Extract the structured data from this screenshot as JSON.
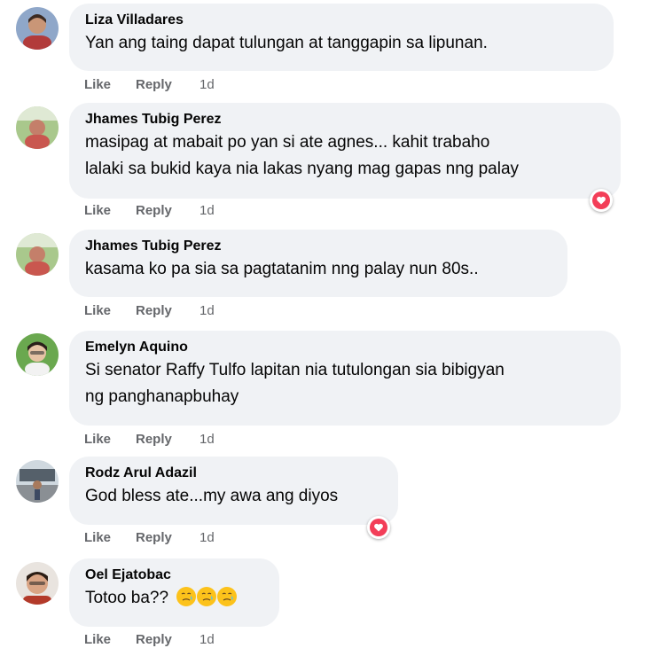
{
  "actions": {
    "like": "Like",
    "reply": "Reply"
  },
  "comments": [
    {
      "author": "Liza Villadares",
      "lines": [
        "Yan ang taing dapat tulungan at tanggapin sa lipunan."
      ],
      "time": "1d",
      "reaction": null
    },
    {
      "author": "Jhames Tubig Perez",
      "lines": [
        "masipag at mabait po yan si ate agnes... kahit trabaho",
        "lalaki sa bukid kaya nia lakas nyang mag gapas nng palay"
      ],
      "time": "1d",
      "reaction": "heart"
    },
    {
      "author": "Jhames Tubig Perez",
      "lines": [
        "kasama ko pa sia sa pagtatanim nng palay nun 80s.."
      ],
      "time": "1d",
      "reaction": null
    },
    {
      "author": "Emelyn Aquino",
      "lines": [
        "Si senator Raffy Tulfo lapitan nia tutulongan sia bibigyan",
        "ng panghanapbuhay"
      ],
      "time": "1d",
      "reaction": null
    },
    {
      "author": "Rodz Arul Adazil",
      "lines": [
        "God bless ate...my awa ang diyos"
      ],
      "time": "1d",
      "reaction": "heart"
    },
    {
      "author": "Oel Ejatobac",
      "lines": [
        "Totoo ba??"
      ],
      "emojis": [
        "crying-face-emoji",
        "crying-face-emoji",
        "crying-face-emoji"
      ],
      "time": "1d",
      "reaction": null
    }
  ],
  "colors": {
    "bubble": "#f0f2f5",
    "meta_text": "#65676b",
    "heart": "#f33e58"
  }
}
